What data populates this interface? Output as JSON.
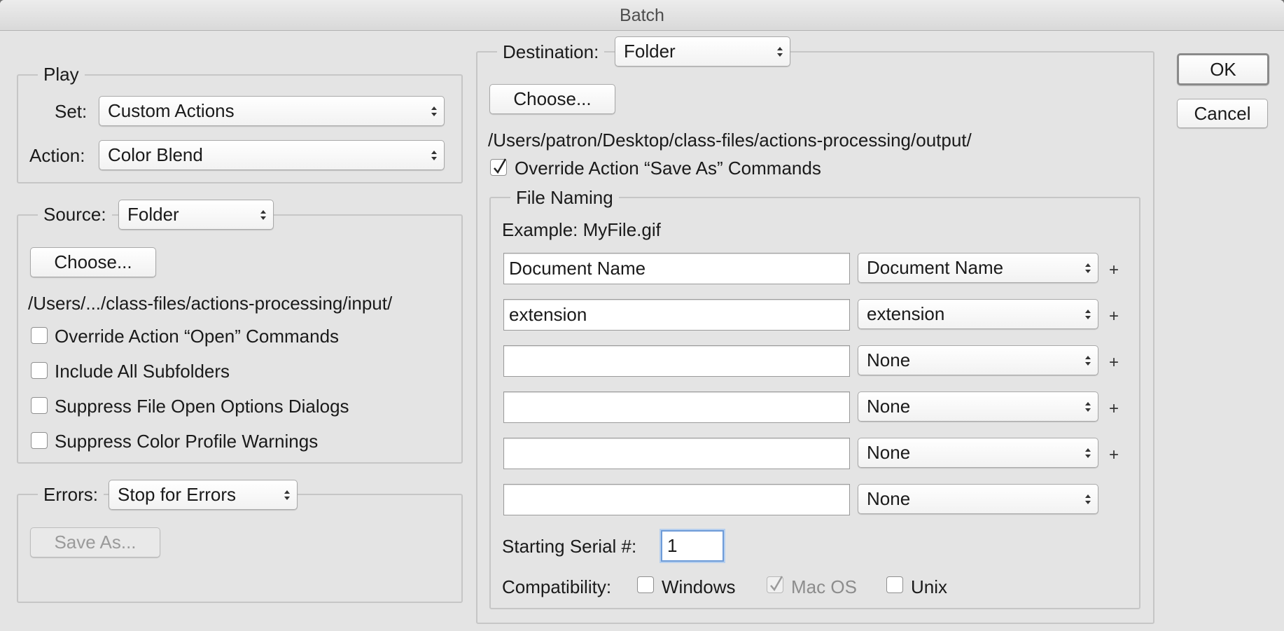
{
  "window": {
    "title": "Batch"
  },
  "buttons": {
    "ok": "OK",
    "cancel": "Cancel"
  },
  "play": {
    "legend": "Play",
    "set_label": "Set:",
    "set_value": "Custom Actions",
    "action_label": "Action:",
    "action_value": "Color Blend"
  },
  "source": {
    "label": "Source:",
    "value": "Folder",
    "choose": "Choose...",
    "path": "/Users/.../class-files/actions-processing/input/",
    "options": [
      {
        "label": "Override Action “Open” Commands",
        "checked": false
      },
      {
        "label": "Include All Subfolders",
        "checked": false
      },
      {
        "label": "Suppress File Open Options Dialogs",
        "checked": false
      },
      {
        "label": "Suppress Color Profile Warnings",
        "checked": false
      }
    ]
  },
  "errors": {
    "label": "Errors:",
    "value": "Stop for Errors",
    "save_as": "Save As..."
  },
  "destination": {
    "label": "Destination:",
    "value": "Folder",
    "choose": "Choose...",
    "path": "/Users/patron/Desktop/class-files/actions-processing/output/",
    "override_label": "Override Action “Save As” Commands",
    "override_checked": true
  },
  "file_naming": {
    "legend": "File Naming",
    "example": "Example: MyFile.gif",
    "rows": [
      {
        "field": "Document Name",
        "select": "Document Name",
        "plus": "+"
      },
      {
        "field": "extension",
        "select": "extension",
        "plus": "+"
      },
      {
        "field": "",
        "select": "None",
        "plus": "+"
      },
      {
        "field": "",
        "select": "None",
        "plus": "+"
      },
      {
        "field": "",
        "select": "None",
        "plus": "+"
      },
      {
        "field": "",
        "select": "None",
        "plus": ""
      }
    ],
    "serial_label": "Starting Serial #:",
    "serial_value": "1",
    "compat_label": "Compatibility:",
    "compat": [
      {
        "label": "Windows",
        "checked": false,
        "enabled": true
      },
      {
        "label": "Mac OS",
        "checked": true,
        "enabled": false
      },
      {
        "label": "Unix",
        "checked": false,
        "enabled": true
      }
    ]
  }
}
